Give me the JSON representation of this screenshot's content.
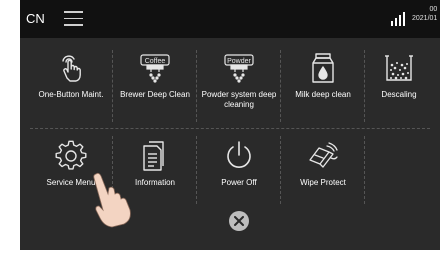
{
  "statusbar": {
    "language": "CN",
    "menu_icon": "hamburger-menu-icon",
    "signal_icon": "signal-bars-icon",
    "time": "00",
    "date": "2021/01"
  },
  "maintenance_menu": {
    "row1": [
      {
        "label": "One-Button Maint.",
        "icon": "finger-tap-icon"
      },
      {
        "label": "Brewer Deep Clean",
        "icon": "coffee-brewer-icon",
        "icon_text": "Coffee"
      },
      {
        "label": "Powder system deep cleaning",
        "icon": "powder-dispenser-icon",
        "icon_text": "Powder"
      },
      {
        "label": "Milk deep clean",
        "icon": "milk-carton-icon"
      },
      {
        "label": "Descaling",
        "icon": "descaling-beaker-icon"
      }
    ],
    "row2": [
      {
        "label": "Service Menu",
        "icon": "gear-icon"
      },
      {
        "label": "Information",
        "icon": "document-icon"
      },
      {
        "label": "Power Off",
        "icon": "power-icon"
      },
      {
        "label": "Wipe Protect",
        "icon": "wipe-hand-icon"
      }
    ],
    "close_icon": "close-icon",
    "pointer_hand": "pointing-hand-icon"
  },
  "colors": {
    "background": "#2a2a2a",
    "statusbar": "#111111",
    "text": "#ffffff",
    "icon_stroke": "#e6e6e6",
    "close_button": "#bdbdbd"
  }
}
